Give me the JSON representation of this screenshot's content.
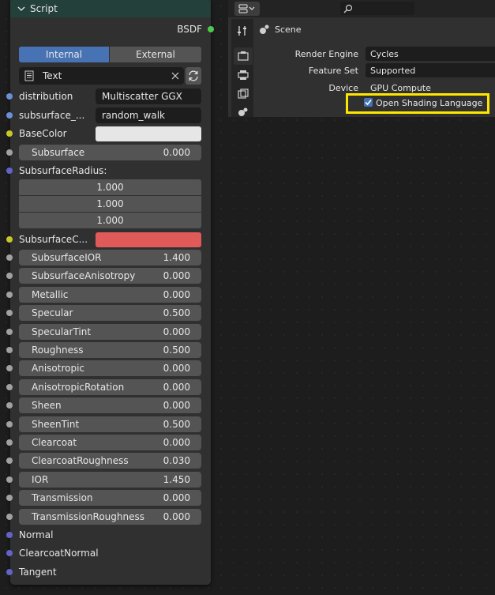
{
  "node": {
    "title": "Script",
    "output_label": "BSDF",
    "mode_internal": "Internal",
    "mode_external": "External",
    "text_block": "Text",
    "distribution_label": "distribution",
    "distribution_value": "Multiscatter GGX",
    "subsurface_method_label": "subsurface_...",
    "subsurface_method_value": "random_walk",
    "basecolor_label": "BaseColor",
    "basecolor_color": "#e6e6e6",
    "subsurface_label": "Subsurface",
    "subsurface_value": "0.000",
    "subsurface_radius_label": "SubsurfaceRadius:",
    "subsurface_radius": [
      "1.000",
      "1.000",
      "1.000"
    ],
    "subsurface_color_label": "SubsurfaceC...",
    "subsurface_color": "#e05a5a",
    "inputs": [
      {
        "name": "SubsurfaceIOR",
        "value": "1.400"
      },
      {
        "name": "SubsurfaceAnisotropy",
        "value": "0.000"
      },
      {
        "name": "Metallic",
        "value": "0.000"
      },
      {
        "name": "Specular",
        "value": "0.500"
      },
      {
        "name": "SpecularTint",
        "value": "0.000"
      },
      {
        "name": "Roughness",
        "value": "0.500"
      },
      {
        "name": "Anisotropic",
        "value": "0.000"
      },
      {
        "name": "AnisotropicRotation",
        "value": "0.000"
      },
      {
        "name": "Sheen",
        "value": "0.000"
      },
      {
        "name": "SheenTint",
        "value": "0.500"
      },
      {
        "name": "Clearcoat",
        "value": "0.000"
      },
      {
        "name": "ClearcoatRoughness",
        "value": "0.030"
      },
      {
        "name": "IOR",
        "value": "1.450"
      },
      {
        "name": "Transmission",
        "value": "0.000"
      },
      {
        "name": "TransmissionRoughness",
        "value": "0.000"
      }
    ],
    "vector_inputs": [
      "Normal",
      "ClearcoatNormal",
      "Tangent"
    ]
  },
  "properties": {
    "search_placeholder": "",
    "breadcrumb": "Scene",
    "render_engine_label": "Render Engine",
    "render_engine_value": "Cycles",
    "feature_set_label": "Feature Set",
    "feature_set_value": "Supported",
    "device_label": "Device",
    "device_value": "GPU Compute",
    "osl_label": "Open Shading Language",
    "osl_checked": true
  },
  "colors": {
    "highlight": "#ffe600",
    "internal_active": "#4772b3"
  }
}
